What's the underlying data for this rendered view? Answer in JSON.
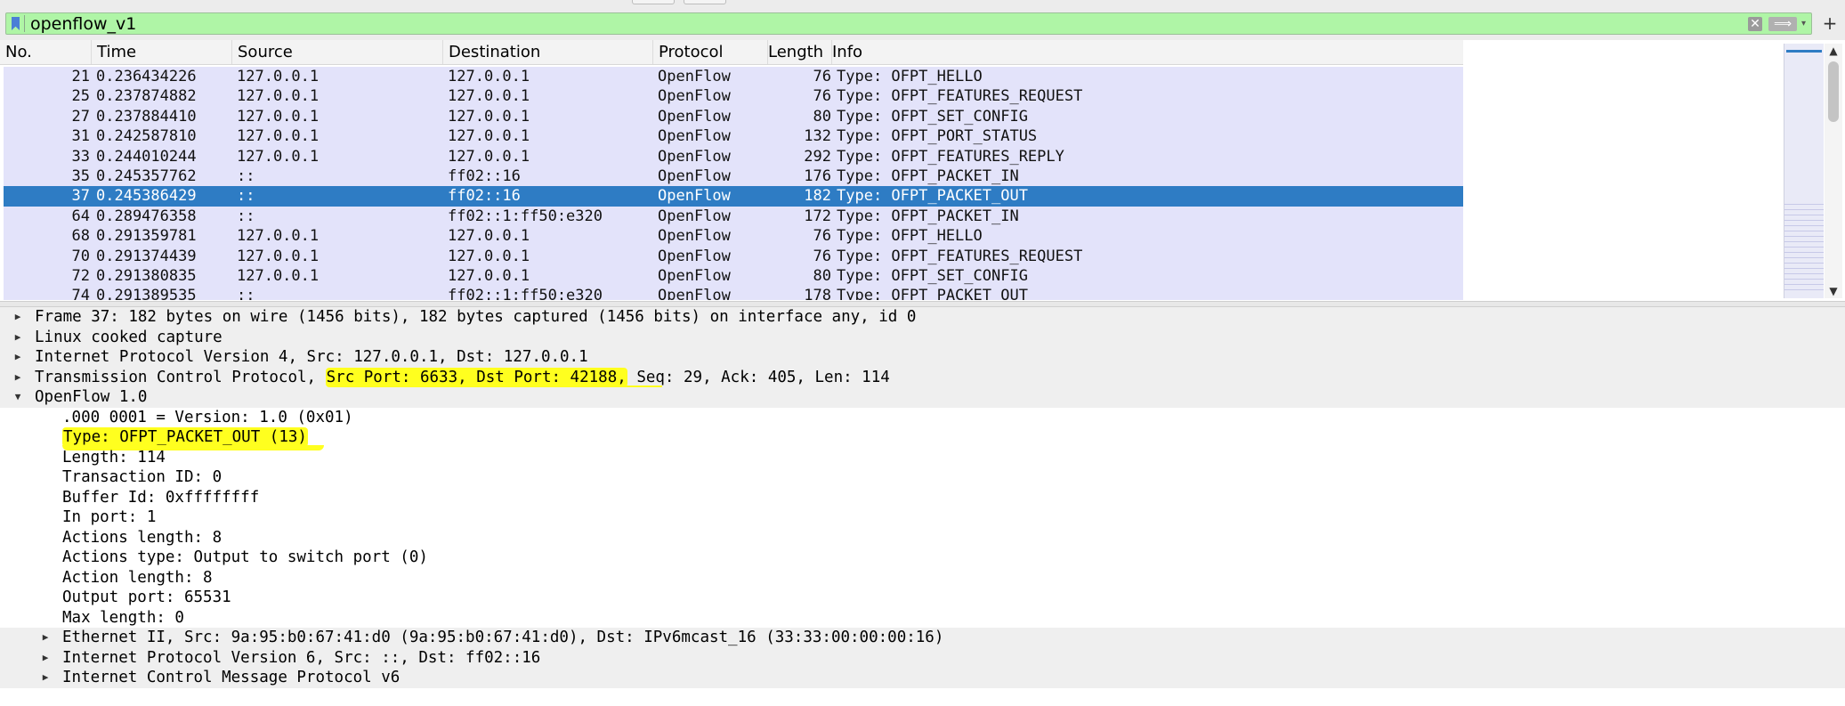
{
  "filter": {
    "value": "openflow_v1",
    "clear_glyph": "✕",
    "apply_glyph": "⟹",
    "dropdown_glyph": "▾",
    "add_glyph": "+"
  },
  "icons": {
    "bookmark": "bookmark-icon",
    "clear": "clear-icon",
    "apply": "arrow-right-icon",
    "dropdown": "chevron-down-icon",
    "add": "plus-icon",
    "expand": "triangle-right-icon",
    "collapse": "triangle-down-icon"
  },
  "packet_list": {
    "columns": [
      "No.",
      "Time",
      "Source",
      "Destination",
      "Protocol",
      "Length",
      "Info"
    ],
    "rows": [
      {
        "no": "21",
        "time": "0.236434226",
        "src": "127.0.0.1",
        "dst": "127.0.0.1",
        "proto": "OpenFlow",
        "len": "76",
        "info": "Type: OFPT_HELLO"
      },
      {
        "no": "25",
        "time": "0.237874882",
        "src": "127.0.0.1",
        "dst": "127.0.0.1",
        "proto": "OpenFlow",
        "len": "76",
        "info": "Type: OFPT_FEATURES_REQUEST"
      },
      {
        "no": "27",
        "time": "0.237884410",
        "src": "127.0.0.1",
        "dst": "127.0.0.1",
        "proto": "OpenFlow",
        "len": "80",
        "info": "Type: OFPT_SET_CONFIG"
      },
      {
        "no": "31",
        "time": "0.242587810",
        "src": "127.0.0.1",
        "dst": "127.0.0.1",
        "proto": "OpenFlow",
        "len": "132",
        "info": "Type: OFPT_PORT_STATUS"
      },
      {
        "no": "33",
        "time": "0.244010244",
        "src": "127.0.0.1",
        "dst": "127.0.0.1",
        "proto": "OpenFlow",
        "len": "292",
        "info": "Type: OFPT_FEATURES_REPLY"
      },
      {
        "no": "35",
        "time": "0.245357762",
        "src": "::",
        "dst": "ff02::16",
        "proto": "OpenFlow",
        "len": "176",
        "info": "Type: OFPT_PACKET_IN"
      },
      {
        "no": "37",
        "time": "0.245386429",
        "src": "::",
        "dst": "ff02::16",
        "proto": "OpenFlow",
        "len": "182",
        "info": "Type: OFPT_PACKET_OUT",
        "selected": true
      },
      {
        "no": "64",
        "time": "0.289476358",
        "src": "::",
        "dst": "ff02::1:ff50:e320",
        "proto": "OpenFlow",
        "len": "172",
        "info": "Type: OFPT_PACKET_IN"
      },
      {
        "no": "68",
        "time": "0.291359781",
        "src": "127.0.0.1",
        "dst": "127.0.0.1",
        "proto": "OpenFlow",
        "len": "76",
        "info": "Type: OFPT_HELLO"
      },
      {
        "no": "70",
        "time": "0.291374439",
        "src": "127.0.0.1",
        "dst": "127.0.0.1",
        "proto": "OpenFlow",
        "len": "76",
        "info": "Type: OFPT_FEATURES_REQUEST"
      },
      {
        "no": "72",
        "time": "0.291380835",
        "src": "127.0.0.1",
        "dst": "127.0.0.1",
        "proto": "OpenFlow",
        "len": "80",
        "info": "Type: OFPT_SET_CONFIG"
      },
      {
        "no": "74",
        "time": "0.291389535",
        "src": "::",
        "dst": "ff02::1:ff50:e320",
        "proto": "OpenFlow",
        "len": "178",
        "info": "Type: OFPT_PACKET_OUT"
      }
    ]
  },
  "scroll": {
    "up_glyph": "▲",
    "down_glyph": "▼"
  },
  "details": {
    "frame": "Frame 37: 182 bytes on wire (1456 bits), 182 bytes captured (1456 bits) on interface any, id 0",
    "linux": "Linux cooked capture",
    "ipv4": "Internet Protocol Version 4, Src: 127.0.0.1, Dst: 127.0.0.1",
    "tcp_prefix": "Transmission Control Protocol, ",
    "tcp_highlight": "Src Port: 6633, Dst Port: 42188,",
    "tcp_suffix": " Seq: 29, Ack: 405, Len: 114",
    "openflow": "OpenFlow 1.0",
    "fields": {
      "version": ".000 0001 = Version: 1.0 (0x01)",
      "type": "Type: OFPT_PACKET_OUT (13)",
      "length": "Length: 114",
      "xid": "Transaction ID: 0",
      "buffer": "Buffer Id: 0xffffffff",
      "in_port": "In port: 1",
      "actions_length": "Actions length: 8",
      "actions_type": "Actions type: Output to switch port (0)",
      "action_length": "Action length: 8",
      "output_port": "Output port: 65531",
      "max_length": "Max length: 0"
    },
    "eth": "Ethernet II, Src: 9a:95:b0:67:41:d0 (9a:95:b0:67:41:d0), Dst: IPv6mcast_16 (33:33:00:00:00:16)",
    "ipv6": "Internet Protocol Version 6, Src: ::, Dst: ff02::16",
    "icmpv6": "Internet Control Message Protocol v6"
  }
}
